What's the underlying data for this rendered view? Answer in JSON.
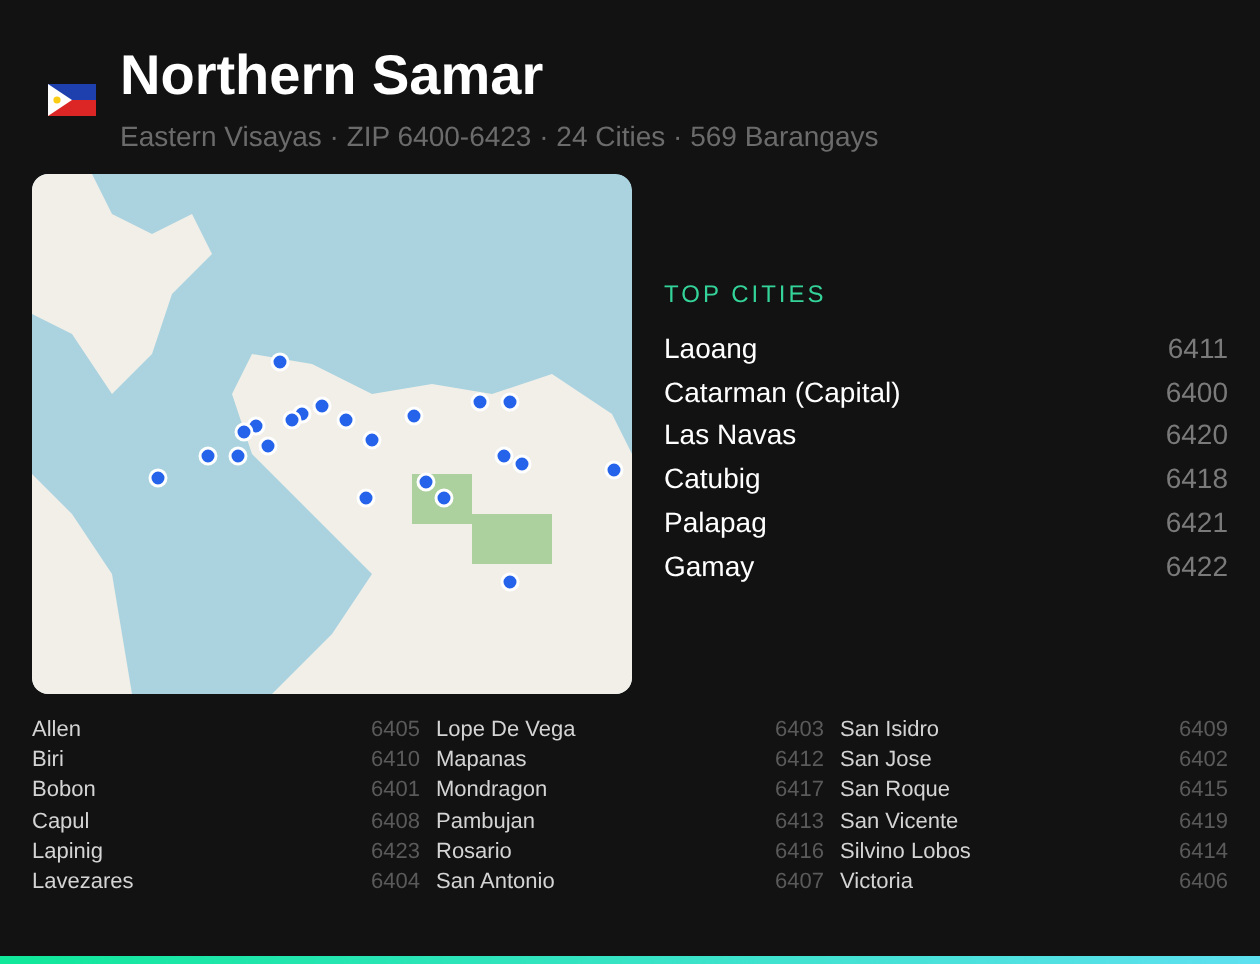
{
  "header": {
    "title": "Northern Samar",
    "subtitle": "Eastern Visayas · ZIP 6400-6423 · 24 Cities · 569 Barangays"
  },
  "top_cities": {
    "heading": "TOP CITIES",
    "items": [
      {
        "name": "Laoang",
        "zip": "6411"
      },
      {
        "name": "Catarman (Capital)",
        "zip": "6400"
      },
      {
        "name": "Las Navas",
        "zip": "6420"
      },
      {
        "name": "Catubig",
        "zip": "6418"
      },
      {
        "name": "Palapag",
        "zip": "6421"
      },
      {
        "name": "Gamay",
        "zip": "6422"
      }
    ]
  },
  "all_cities": [
    {
      "name": "Allen",
      "zip": "6405"
    },
    {
      "name": "Biri",
      "zip": "6410"
    },
    {
      "name": "Bobon",
      "zip": "6401"
    },
    {
      "name": "Capul",
      "zip": "6408"
    },
    {
      "name": "Lapinig",
      "zip": "6423"
    },
    {
      "name": "Lavezares",
      "zip": "6404"
    },
    {
      "name": "Lope De Vega",
      "zip": "6403"
    },
    {
      "name": "Mapanas",
      "zip": "6412"
    },
    {
      "name": "Mondragon",
      "zip": "6417"
    },
    {
      "name": "Pambujan",
      "zip": "6413"
    },
    {
      "name": "Rosario",
      "zip": "6416"
    },
    {
      "name": "San Antonio",
      "zip": "6407"
    },
    {
      "name": "San Isidro",
      "zip": "6409"
    },
    {
      "name": "San Jose",
      "zip": "6402"
    },
    {
      "name": "San Roque",
      "zip": "6415"
    },
    {
      "name": "San Vicente",
      "zip": "6419"
    },
    {
      "name": "Silvino Lobos",
      "zip": "6414"
    },
    {
      "name": "Victoria",
      "zip": "6406"
    }
  ]
}
